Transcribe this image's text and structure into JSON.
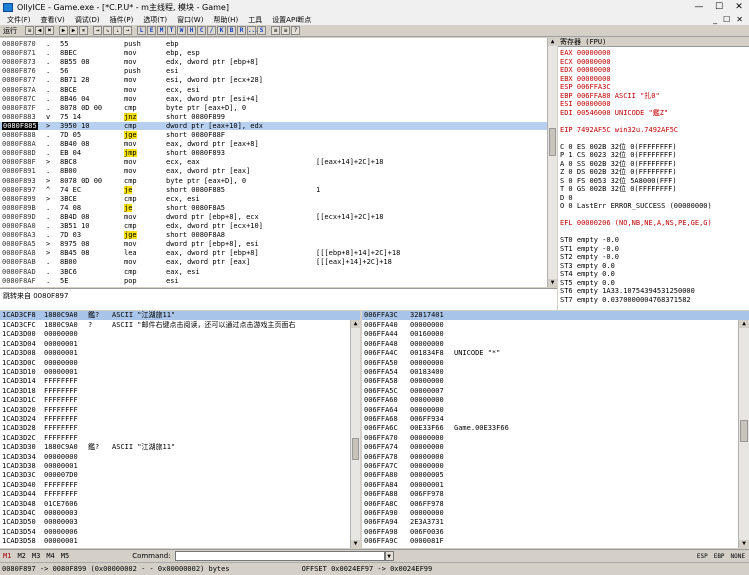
{
  "window": {
    "title": "OllyICE - Game.exe - [*C.P.U* - m主线程, 模块 - Game]",
    "min": "—",
    "max": "☐",
    "close": "✕"
  },
  "menu": [
    "文件(F)",
    "查看(V)",
    "调试(D)",
    "插件(P)",
    "选项(T)",
    "窗口(W)",
    "帮助(H)",
    "工具",
    "设置API断点"
  ],
  "mdi": [
    "_",
    "☐",
    "✕"
  ],
  "toolbar": {
    "status": "运行",
    "buttons": [
      "≡",
      "◀",
      "✖",
      "▶",
      "▶",
      "⏸",
      "⇥",
      "⇘",
      "⇣",
      "→"
    ],
    "letters": [
      "L",
      "E",
      "M",
      "T",
      "W",
      "H",
      "C",
      "/",
      "K",
      "B",
      "R",
      "...",
      "S"
    ],
    "extra": [
      "≡",
      "≡",
      "?"
    ]
  },
  "cpu": {
    "rows": [
      {
        "addr": "0080F870",
        "mark": ".",
        "hex": "55",
        "mn": "push",
        "op": "ebp",
        "cm": ""
      },
      {
        "addr": "0080F871",
        "mark": ".",
        "hex": "8BEC",
        "mn": "mov",
        "op": "ebp, esp",
        "cm": ""
      },
      {
        "addr": "0080F873",
        "mark": ".",
        "hex": "8B55 08",
        "mn": "mov",
        "op": "edx, dword ptr [ebp+8]",
        "cm": ""
      },
      {
        "addr": "0080F876",
        "mark": ".",
        "hex": "56",
        "mn": "push",
        "op": "esi",
        "cm": ""
      },
      {
        "addr": "0080F877",
        "mark": ".",
        "hex": "8B71 28",
        "mn": "mov",
        "op": "esi, dword ptr [ecx+28]",
        "cm": ""
      },
      {
        "addr": "0080F87A",
        "mark": ".",
        "hex": "8BCE",
        "mn": "mov",
        "op": "ecx, esi",
        "cm": ""
      },
      {
        "addr": "0080F87C",
        "mark": ".",
        "hex": "8B46 04",
        "mn": "mov",
        "op": "eax, dword ptr [esi+4]",
        "cm": ""
      },
      {
        "addr": "0080F87F",
        "mark": ".",
        "hex": "8078 0D 00",
        "mn": "cmp",
        "op": "byte ptr [eax+D], 0",
        "cm": ""
      },
      {
        "addr": "0080F883",
        "mark": "v",
        "hex": "75 14",
        "mn": "jnz",
        "op": "short 0080F899",
        "cm": ""
      },
      {
        "addr": "0080F885",
        "mark": ">",
        "hex": "3950 10",
        "mn": "cmp",
        "op": "dword ptr [eax+10], edx",
        "cm": ""
      },
      {
        "addr": "0080F888",
        "mark": ".",
        "hex": "7D 05",
        "mn": "jge",
        "op": "short 0080F88F",
        "cm": ""
      },
      {
        "addr": "0080F88A",
        "mark": ".",
        "hex": "8B40 08",
        "mn": "mov",
        "op": "eax, dword ptr [eax+8]",
        "cm": ""
      },
      {
        "addr": "0080F88D",
        "mark": ".",
        "hex": "EB 04",
        "mn": "jmp",
        "op": "short 0080F893",
        "cm": ""
      },
      {
        "addr": "0080F88F",
        "mark": ">",
        "hex": "8BC8",
        "mn": "mov",
        "op": "ecx, eax",
        "cm": "[[eax+14]+2C]+18"
      },
      {
        "addr": "0080F891",
        "mark": ".",
        "hex": "8B00",
        "mn": "mov",
        "op": "eax, dword ptr [eax]",
        "cm": ""
      },
      {
        "addr": "0080F893",
        "mark": ">",
        "hex": "8078 0D 00",
        "mn": "cmp",
        "op": "byte ptr [eax+D], 0",
        "cm": ""
      },
      {
        "addr": "0080F897",
        "mark": "^",
        "hex": "74 EC",
        "mn": "je",
        "op": "short 0080F885",
        "cm": "1"
      },
      {
        "addr": "0080F899",
        "mark": ">",
        "hex": "3BCE",
        "mn": "cmp",
        "op": "ecx, esi",
        "cm": ""
      },
      {
        "addr": "0080F89B",
        "mark": ".",
        "hex": "74 08",
        "mn": "je",
        "op": "short 0080F8A5",
        "cm": ""
      },
      {
        "addr": "0080F89D",
        "mark": ".",
        "hex": "8B4D 08",
        "mn": "mov",
        "op": "dword ptr [ebp+8], ecx",
        "cm": "[[ecx+14]+2C]+18"
      },
      {
        "addr": "0080F8A0",
        "mark": ".",
        "hex": "3B51 10",
        "mn": "cmp",
        "op": "edx, dword ptr [ecx+10]",
        "cm": ""
      },
      {
        "addr": "0080F8A3",
        "mark": ".",
        "hex": "7D 03",
        "mn": "jge",
        "op": "short 0080F8A8",
        "cm": ""
      },
      {
        "addr": "0080F8A5",
        "mark": ">",
        "hex": "8975 08",
        "mn": "mov",
        "op": "dword ptr [ebp+8], esi",
        "cm": ""
      },
      {
        "addr": "0080F8A8",
        "mark": ">",
        "hex": "8B45 08",
        "mn": "lea",
        "op": "eax, dword ptr [ebp+8]",
        "cm": "[[[ebp+8]+14]+2C]+18"
      },
      {
        "addr": "0080F8AB",
        "mark": ".",
        "hex": "8B00",
        "mn": "mov",
        "op": "eax, dword ptr [eax]",
        "cm": "[[[eax]+14]+2C]+18"
      },
      {
        "addr": "0080F8AD",
        "mark": ".",
        "hex": "3BC6",
        "mn": "cmp",
        "op": "eax, esi",
        "cm": ""
      },
      {
        "addr": "0080F8AF",
        "mark": ".",
        "hex": "5E",
        "mn": "pop",
        "op": "esi",
        "cm": ""
      }
    ]
  },
  "info": {
    "text": "跳转来自 0080F897"
  },
  "registers": {
    "title": "寄存器 (FPU)",
    "lines": [
      "EAX 00000000",
      "ECX 00000000",
      "EDX 00000000",
      "EBX 00000000",
      "ESP 006FFA3C",
      "EBP 006FFA80 ASCII \"扎0\"",
      "ESI 00000000",
      "EDI 00546000 UNICODE \"鑑Z\"",
      "",
      "EIP 7492AF5C win32u.7492AF5C",
      "",
      "C 0  ES 002B 32位 0(FFFFFFFF)",
      "P 1  CS 0023 32位 0(FFFFFFFF)",
      "A 0  SS 002B 32位 0(FFFFFFFF)",
      "Z 0  DS 002B 32位 0(FFFFFFFF)",
      "S 0  FS 0053 32位 5A8000(FFF)",
      "T 0  GS 002B 32位 0(FFFFFFFF)",
      "D 0",
      "O 0  LastErr ERROR_SUCCESS (00000000)",
      "",
      "EFL 00000206 (NO,NB,NE,A,NS,PE,GE,G)",
      "",
      "ST0 empty -0.0",
      "ST1 empty -0.0",
      "ST2 empty -0.0",
      "ST3 empty 0.0",
      "ST4 empty 0.0",
      "ST5 empty 0.0",
      "ST6 empty 1A33.10754394531250000",
      "ST7 empty 0.0370000004768371582"
    ]
  },
  "dump": {
    "header": {
      "addr": "1CAD3CF8",
      "hex": "1880C9A0",
      "asc": "鑑?",
      "txt": "ASCII \"江湖旅11\""
    },
    "rows": [
      [
        "1CAD3CFC",
        "1880C9A0",
        "?",
        "ASCII \"邮件右键点击阅读，还可以通过点击游戏主页面右"
      ],
      [
        "1CAD3D00",
        "00000000",
        "",
        ""
      ],
      [
        "1CAD3D04",
        "00000001",
        "",
        ""
      ],
      [
        "1CAD3D08",
        "00000001",
        "",
        ""
      ],
      [
        "1CAD3D0C",
        "00000000",
        "",
        ""
      ],
      [
        "1CAD3D10",
        "00000001",
        "",
        ""
      ],
      [
        "1CAD3D14",
        "FFFFFFFF",
        "",
        ""
      ],
      [
        "1CAD3D18",
        "FFFFFFFF",
        "",
        ""
      ],
      [
        "1CAD3D1C",
        "FFFFFFFF",
        "",
        ""
      ],
      [
        "1CAD3D20",
        "FFFFFFFF",
        "",
        ""
      ],
      [
        "1CAD3D24",
        "FFFFFFFF",
        "",
        ""
      ],
      [
        "1CAD3D28",
        "FFFFFFFF",
        "",
        ""
      ],
      [
        "1CAD3D2C",
        "FFFFFFFF",
        "",
        ""
      ],
      [
        "1CAD3D30",
        "1880C9A0",
        "鑑?",
        "ASCII \"江湖旅11\""
      ],
      [
        "1CAD3D34",
        "00000000",
        "",
        ""
      ],
      [
        "1CAD3D38",
        "00000001",
        "",
        ""
      ],
      [
        "1CAD3D3C",
        "000007D0",
        "",
        ""
      ],
      [
        "1CAD3D40",
        "FFFFFFFF",
        "",
        ""
      ],
      [
        "1CAD3D44",
        "FFFFFFFF",
        "",
        ""
      ],
      [
        "1CAD3D48",
        "01CE7606",
        "",
        ""
      ],
      [
        "1CAD3D4C",
        "00000003",
        "",
        ""
      ],
      [
        "1CAD3D50",
        "00000003",
        "",
        ""
      ],
      [
        "1CAD3D54",
        "00000006",
        "",
        ""
      ],
      [
        "1CAD3D58",
        "00000001",
        "",
        ""
      ]
    ]
  },
  "stack": {
    "header": {
      "addr": "006FFA3C",
      "val": "32817401"
    },
    "rows": [
      [
        "006FFA40",
        "00000000",
        ""
      ],
      [
        "006FFA44",
        "00160000",
        ""
      ],
      [
        "006FFA48",
        "00000000",
        ""
      ],
      [
        "006FFA4C",
        "001834F8",
        "UNICODE \"*\""
      ],
      [
        "006FFA50",
        "00000000",
        ""
      ],
      [
        "006FFA54",
        "00183400",
        ""
      ],
      [
        "006FFA58",
        "00000000",
        ""
      ],
      [
        "006FFA5C",
        "00000007",
        ""
      ],
      [
        "006FFA60",
        "00000000",
        ""
      ],
      [
        "006FFA64",
        "00000000",
        ""
      ],
      [
        "006FFA68",
        "006FF934",
        ""
      ],
      [
        "006FFA6C",
        "00E33F66",
        "Game.00E33F66"
      ],
      [
        "006FFA70",
        "00000000",
        ""
      ],
      [
        "006FFA74",
        "00000000",
        ""
      ],
      [
        "006FFA78",
        "00000000",
        ""
      ],
      [
        "006FFA7C",
        "00000000",
        ""
      ],
      [
        "006FFA80",
        "00000005",
        ""
      ],
      [
        "006FFA84",
        "00000001",
        ""
      ],
      [
        "006FFA88",
        "006FF978",
        ""
      ],
      [
        "006FFA8C",
        "006FF978",
        ""
      ],
      [
        "006FFA90",
        "00000000",
        ""
      ],
      [
        "006FFA94",
        "2E3A3731",
        ""
      ],
      [
        "006FFA98",
        "006F0036",
        ""
      ],
      [
        "006FFA9C",
        "0000081F",
        ""
      ]
    ]
  },
  "cmdbar": {
    "tabs": [
      "M1",
      "M2",
      "M3",
      "M4",
      "M5"
    ],
    "label": "Command:",
    "right": [
      "ESP",
      "EBP",
      "NONE"
    ]
  },
  "statusbar": {
    "left": "0080F897 -> 0080F899 (0x00000002 - -  0x00000002) bytes",
    "right": "OFFSET 0x0024EF97 -> 0x0024EF99"
  },
  "colors": {
    "selected_row": "#b8d0f0",
    "jump_yellow": "#f4e010",
    "mem_cyan": "#2ab4e8",
    "reg_red": "#c00000",
    "dump_header": "#a8c4e8"
  }
}
